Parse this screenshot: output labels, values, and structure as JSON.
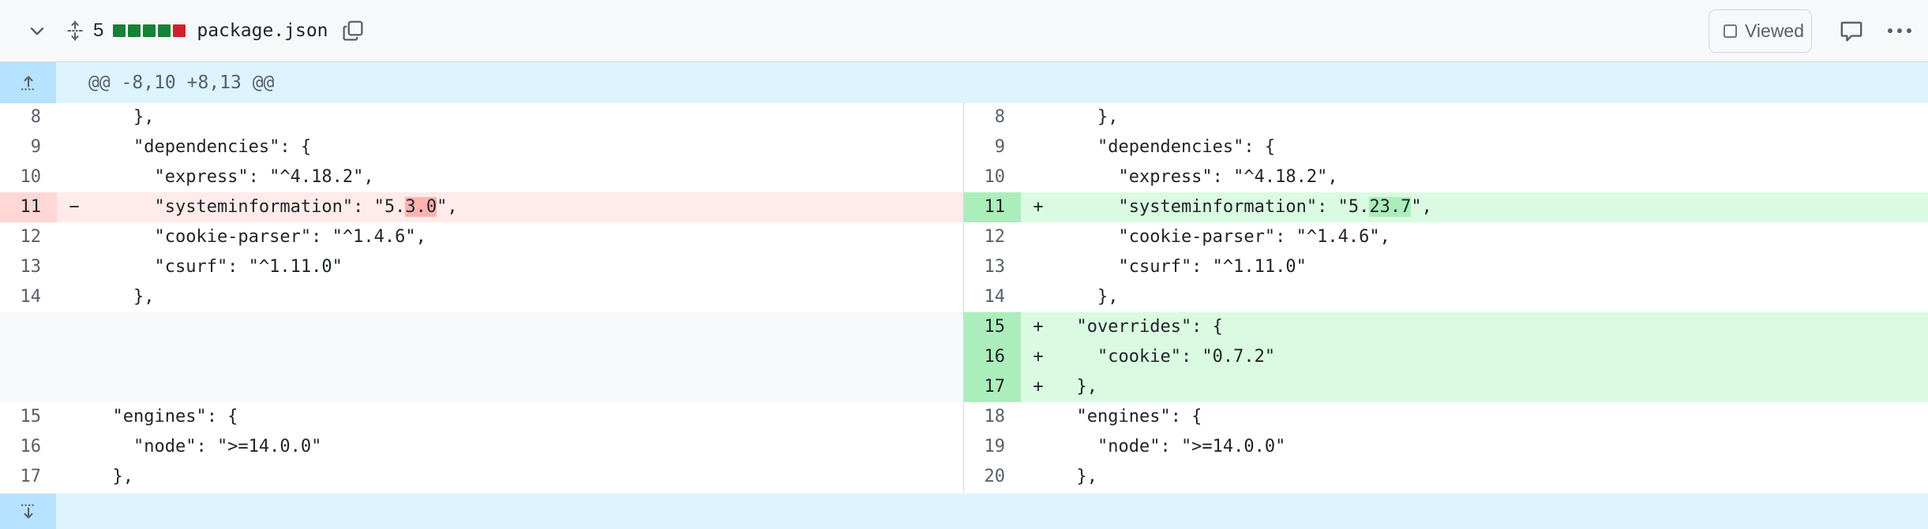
{
  "file": {
    "changes_count": "5",
    "name": "package.json",
    "viewed_label": "Viewed",
    "diffstat": [
      "#1a7f37",
      "#1a7f37",
      "#1a7f37",
      "#1a7f37",
      "#cf222e"
    ]
  },
  "hunk_header": "@@ -8,10 +8,13 @@",
  "left": [
    {
      "num": "8",
      "sign": "",
      "code": "    },"
    },
    {
      "num": "9",
      "sign": "",
      "code": "    \"dependencies\": {"
    },
    {
      "num": "10",
      "sign": "",
      "code": "      \"express\": \"^4.18.2\","
    },
    {
      "num": "11",
      "sign": "−",
      "code_pre": "      \"systeminformation\": \"5.",
      "code_hl": "3.0",
      "code_post": "\","
    },
    {
      "num": "12",
      "sign": "",
      "code": "      \"cookie-parser\": \"^1.4.6\","
    },
    {
      "num": "13",
      "sign": "",
      "code": "      \"csurf\": \"^1.11.0\""
    },
    {
      "num": "14",
      "sign": "",
      "code": "    },"
    },
    {
      "num": "15",
      "sign": "",
      "code": "  \"engines\": {"
    },
    {
      "num": "16",
      "sign": "",
      "code": "    \"node\": \">=14.0.0\""
    },
    {
      "num": "17",
      "sign": "",
      "code": "  },"
    }
  ],
  "right": [
    {
      "num": "8",
      "sign": "",
      "code": "    },"
    },
    {
      "num": "9",
      "sign": "",
      "code": "    \"dependencies\": {"
    },
    {
      "num": "10",
      "sign": "",
      "code": "      \"express\": \"^4.18.2\","
    },
    {
      "num": "11",
      "sign": "+",
      "code_pre": "      \"systeminformation\": \"5.",
      "code_hl": "23.7",
      "code_post": "\","
    },
    {
      "num": "12",
      "sign": "",
      "code": "      \"cookie-parser\": \"^1.4.6\","
    },
    {
      "num": "13",
      "sign": "",
      "code": "      \"csurf\": \"^1.11.0\""
    },
    {
      "num": "14",
      "sign": "",
      "code": "    },"
    },
    {
      "num": "15",
      "sign": "+",
      "code": "  \"overrides\": {"
    },
    {
      "num": "16",
      "sign": "+",
      "code": "    \"cookie\": \"0.7.2\""
    },
    {
      "num": "17",
      "sign": "+",
      "code": "  },"
    },
    {
      "num": "18",
      "sign": "",
      "code": "  \"engines\": {"
    },
    {
      "num": "19",
      "sign": "",
      "code": "    \"node\": \">=14.0.0\""
    },
    {
      "num": "20",
      "sign": "",
      "code": "  },"
    }
  ]
}
